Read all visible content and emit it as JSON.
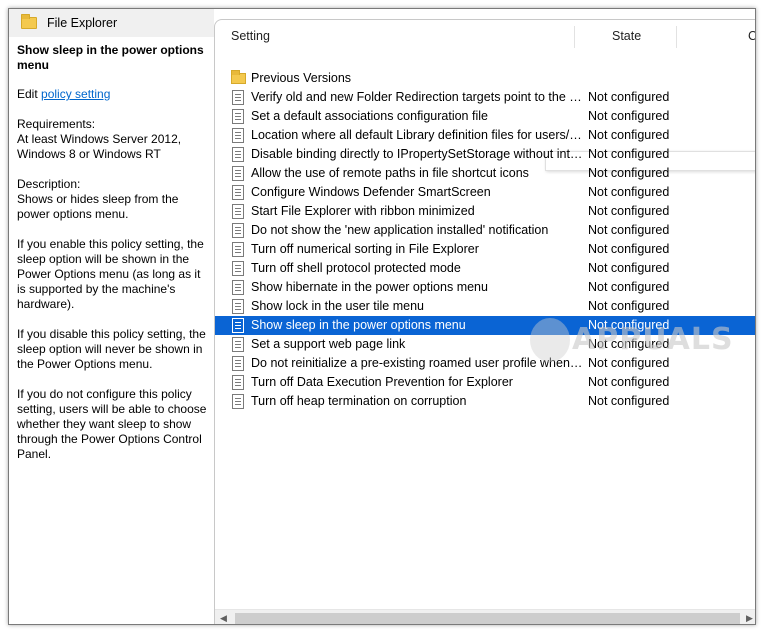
{
  "window": {
    "title": "File Explorer"
  },
  "description": {
    "policy_title": "Show sleep in the power options menu",
    "edit_prefix": "Edit",
    "edit_link": "policy setting",
    "requirements_label": "Requirements:",
    "requirements_value": "At least Windows Server 2012, Windows 8 or Windows RT",
    "description_label": "Description:",
    "description_value": "Shows or hides sleep from the power options menu.",
    "enable_text": "If you enable this policy setting, the sleep option will be shown in the Power Options menu (as long as it is supported by the machine's hardware).",
    "disable_text": "If you disable this policy setting, the sleep option will never be shown in the Power Options menu.",
    "notconfig_text": "If you do not configure this policy setting, users will be able to choose whether they want sleep to show through the Power Options Control Panel."
  },
  "table": {
    "headers": {
      "setting": "Setting",
      "state": "State",
      "comment": "C"
    },
    "rows": [
      {
        "icon": "folder-icon",
        "name": "Previous Versions",
        "state": ""
      },
      {
        "icon": "policy-icon",
        "name": "Verify old and new Folder Redirection targets point to the same share before redirecting",
        "state": "Not configured"
      },
      {
        "icon": "policy-icon",
        "name": "Set a default associations configuration file",
        "state": "Not configured"
      },
      {
        "icon": "policy-icon",
        "name": "Location where all default Library definition files for users/machines reside",
        "state": "Not configured"
      },
      {
        "icon": "policy-icon",
        "name": "Disable binding directly to IPropertySetStorage without intermediate layers",
        "state": "Not configured"
      },
      {
        "icon": "policy-icon",
        "name": "Allow the use of remote paths in file shortcut icons",
        "state": "Not configured"
      },
      {
        "icon": "policy-icon",
        "name": "Configure Windows Defender SmartScreen",
        "state": "Not configured"
      },
      {
        "icon": "policy-icon",
        "name": "Start File Explorer with ribbon minimized",
        "state": "Not configured"
      },
      {
        "icon": "policy-icon",
        "name": "Do not show the 'new application installed' notification",
        "state": "Not configured"
      },
      {
        "icon": "policy-icon",
        "name": "Turn off numerical sorting in File Explorer",
        "state": "Not configured"
      },
      {
        "icon": "policy-icon",
        "name": "Turn off shell protocol protected mode",
        "state": "Not configured"
      },
      {
        "icon": "policy-icon",
        "name": "Show hibernate in the power options menu",
        "state": "Not configured"
      },
      {
        "icon": "policy-icon",
        "name": "Show lock in the user tile menu",
        "state": "Not configured"
      },
      {
        "icon": "policy-icon",
        "name": "Show sleep in the power options menu",
        "state": "Not configured",
        "selected": true
      },
      {
        "icon": "policy-icon",
        "name": "Set a support web page link",
        "state": "Not configured"
      },
      {
        "icon": "policy-icon",
        "name": "Do not reinitialize a pre-existing roamed user profile when it is loaded on a machine for the first time",
        "state": "Not configured"
      },
      {
        "icon": "policy-icon",
        "name": "Turn off Data Execution Prevention for Explorer",
        "state": "Not configured"
      },
      {
        "icon": "policy-icon",
        "name": "Turn off heap termination on corruption",
        "state": "Not configured"
      }
    ]
  },
  "watermark": {
    "text": "APPUALS"
  },
  "colors": {
    "selection": "#0a64d4",
    "link": "#0066cc"
  }
}
